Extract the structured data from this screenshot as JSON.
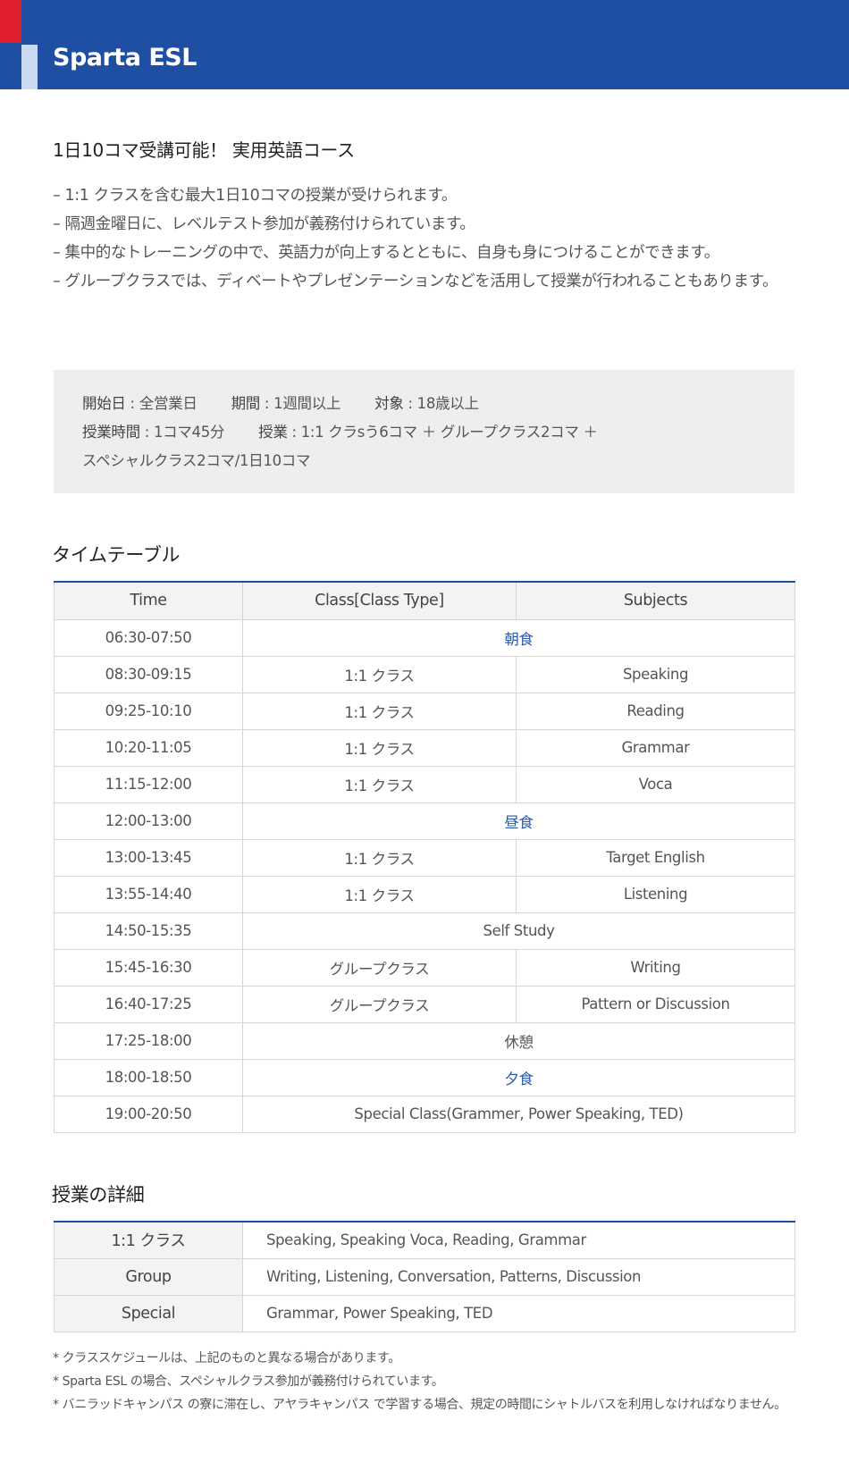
{
  "header": {
    "title": "Sparta ESL"
  },
  "intro": {
    "heading": "1日10コマ受講可能！ 実用英語コース",
    "bullets": [
      "– 1:1 クラスを含む最大1日10コマの授業が受けられます。",
      "– 隔週金曜日に、レベルテスト参加が義務付けられています。",
      "– 集中的なトレーニングの中で、英語力が向上するとともに、自身も身につけることができます。",
      "– グループクラスでは、ディベートやプレゼンテーションなどを活用して授業が行われることもあります。"
    ]
  },
  "info": {
    "start_label": "開始日",
    "start_value": " : 全営業日",
    "period_label": "期間",
    "period_value": " : 1週間以上",
    "target_label": "対象",
    "target_value": " : 18歳以上",
    "hours_label": "授業時間",
    "hours_value": " : 1コマ45分",
    "lessons_label": "授業",
    "lessons_value": " : 1:1 クラsう6コマ ＋ グループクラス2コマ ＋",
    "lessons_value_2": "スペシャルクラス2コマ/1日10コマ"
  },
  "timetable": {
    "title": "タイムテーブル",
    "headers": [
      "Time",
      "Class[Class Type]",
      "Subjects"
    ],
    "rows": [
      {
        "time": "06:30-07:50",
        "merged": "朝食"
      },
      {
        "time": "08:30-09:15",
        "class": "1:1 クラス",
        "subject": "Speaking"
      },
      {
        "time": "09:25-10:10",
        "class": "1:1 クラス",
        "subject": "Reading"
      },
      {
        "time": "10:20-11:05",
        "class": "1:1 クラス",
        "subject": "Grammar"
      },
      {
        "time": "11:15-12:00",
        "class": "1:1 クラス",
        "subject": "Voca"
      },
      {
        "time": "12:00-13:00",
        "merged": "昼食"
      },
      {
        "time": "13:00-13:45",
        "class": "1:1 クラス",
        "subject": "Target English"
      },
      {
        "time": "13:55-14:40",
        "class": "1:1 クラス",
        "subject": "Listening"
      },
      {
        "time": "14:50-15:35",
        "merged": "Self Study"
      },
      {
        "time": "15:45-16:30",
        "class": "グループクラス",
        "subject": "Writing"
      },
      {
        "time": "16:40-17:25",
        "class": "グループクラス",
        "subject": "Pattern or Discussion"
      },
      {
        "time": "17:25-18:00",
        "merged": "休憩"
      },
      {
        "time": "18:00-18:50",
        "merged": "夕食"
      },
      {
        "time": "19:00-20:50",
        "merged": "Special Class(Grammer, Power Speaking, TED)"
      }
    ]
  },
  "details": {
    "title": "授業の詳細",
    "rows": [
      {
        "label": "1:1 クラス",
        "content": "Speaking, Speaking Voca, Reading, Grammar"
      },
      {
        "label": "Group",
        "content": "Writing, Listening, Conversation, Patterns, Discussion"
      },
      {
        "label": "Special",
        "content": "Grammar, Power Speaking, TED"
      }
    ]
  },
  "notes": [
    "* クラススケジュールは、上記のものと異なる場合があります。",
    "* Sparta ESL の場合、スペシャルクラス参加が義務付けられています。",
    "* バニラッドキャンパス の寮に滞在し、アヤラキャンパス で学習する場合、規定の時間にシャトルバスを利用しなければなりません。"
  ],
  "colors": {
    "header_bg": "#1e4fa3",
    "accent_red": "#e0202e",
    "meal_text": "#2b5aa6",
    "info_bg": "#eeeeee"
  }
}
